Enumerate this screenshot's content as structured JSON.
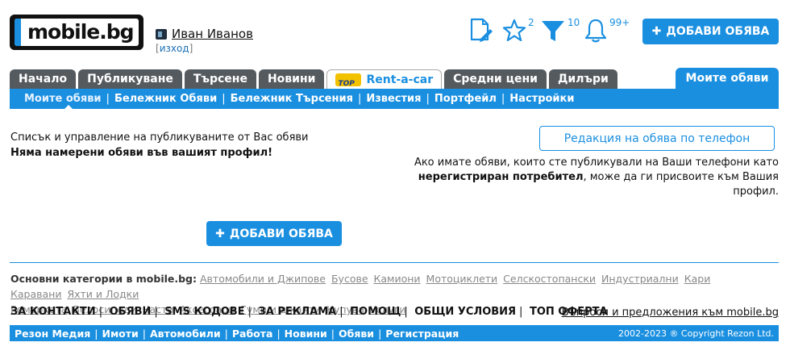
{
  "header": {
    "logo_text": "mobile.bg",
    "user_name": "Иван Иванов",
    "logout_label": "изход",
    "favorites_count": "2",
    "filters_count": "10",
    "notifications_count": "99+",
    "add_button_label": "ДОБАВИ ОБЯВА"
  },
  "nav": {
    "tabs": [
      "Начало",
      "Публикуване",
      "Търсене",
      "Новини"
    ],
    "rent_label": "Rent-a-car",
    "rent_badge": "TOP",
    "tabs_after": [
      "Средни цени",
      "Дилъри"
    ],
    "my_listings": "Моите обяви"
  },
  "subnav": {
    "items": [
      "Моите обяви",
      "Бележник Обяви",
      "Бележник Търсения",
      "Известия",
      "Портфейл",
      "Настройки"
    ]
  },
  "main": {
    "description": "Списък и управление на публикуваните от Вас обяви",
    "empty_message": "Няма намерени обяви във вашият профил!",
    "phone_button": "Редакция на обява по телефон",
    "phone_note_part1": "Ако имате обяви, които сте публикували на Ваши телефони като",
    "phone_note_bold": "нерегистриран потребител",
    "phone_note_part2": ", може да ги присвоите към Вашия профил.",
    "add_button_label": "ДОБАВИ ОБЯВА"
  },
  "footer": {
    "categories_label": "Основни категории в mobile.bg:",
    "categories": [
      "Автомобили и Джипове",
      "Бусове",
      "Камиони",
      "Мотоциклети",
      "Селскостопански",
      "Индустриални",
      "Кари",
      "Каравани",
      "Яхти и Лодки",
      "Ремаркета",
      "Велосипеди",
      "Части",
      "Аксесоари",
      "Гуми и джанти",
      "Купува",
      "Услуги"
    ],
    "links": [
      "ЗА КОНТАКТИ",
      "ОБЯВИ",
      "SMS КОДОВЕ",
      "ЗА РЕКЛАМА",
      "ПОМОЩ",
      "ОБЩИ УСЛОВИЯ",
      "ТОП ОФЕРТА"
    ],
    "feedback": "Въпроси и предложения към mobile.bg",
    "bottom_links": [
      "Резон Медия",
      "Имоти",
      "Автомобили",
      "Работа",
      "Новини",
      "Обяви",
      "Регистрация"
    ],
    "copyright": "2002-2023 ® Copyright Rezon Ltd."
  },
  "colors": {
    "accent": "#1a8fe0",
    "tab": "#555a5f"
  },
  "icons": [
    "document-edit-icon",
    "star-icon",
    "filter-icon",
    "bell-icon",
    "plus-icon",
    "user-icon"
  ]
}
